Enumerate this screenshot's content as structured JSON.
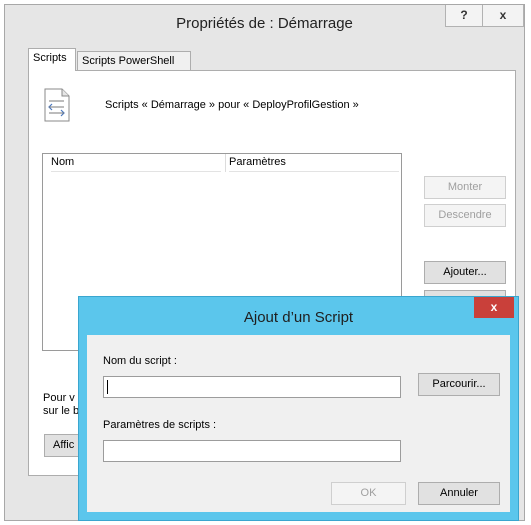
{
  "main_window": {
    "title": "Propriétés de : Démarrage",
    "help_label": "?",
    "close_label": "x",
    "tabs": [
      {
        "label": "Scripts"
      },
      {
        "label": "Scripts PowerShell"
      }
    ],
    "header_text": "Scripts « Démarrage » pour « DeployProfilGestion »",
    "list": {
      "columns": [
        "Nom",
        "Paramètres"
      ]
    },
    "buttons": {
      "monter": "Monter",
      "descendre": "Descendre",
      "ajouter": "Ajouter..."
    },
    "partial_text_line1": "Pour v",
    "partial_text_line2": "sur le b",
    "afficher_partial": "Affic"
  },
  "dialog": {
    "title": "Ajout d’un Script",
    "close_label": "x",
    "script_name_label": "Nom du script :",
    "script_name_value": "",
    "browse_label": "Parcourir...",
    "script_params_label": "Paramètres de scripts :",
    "script_params_value": "",
    "ok_label": "OK",
    "cancel_label": "Annuler"
  },
  "colors": {
    "dialog_frame": "#5bc6ec",
    "close_button": "#c9403a"
  }
}
